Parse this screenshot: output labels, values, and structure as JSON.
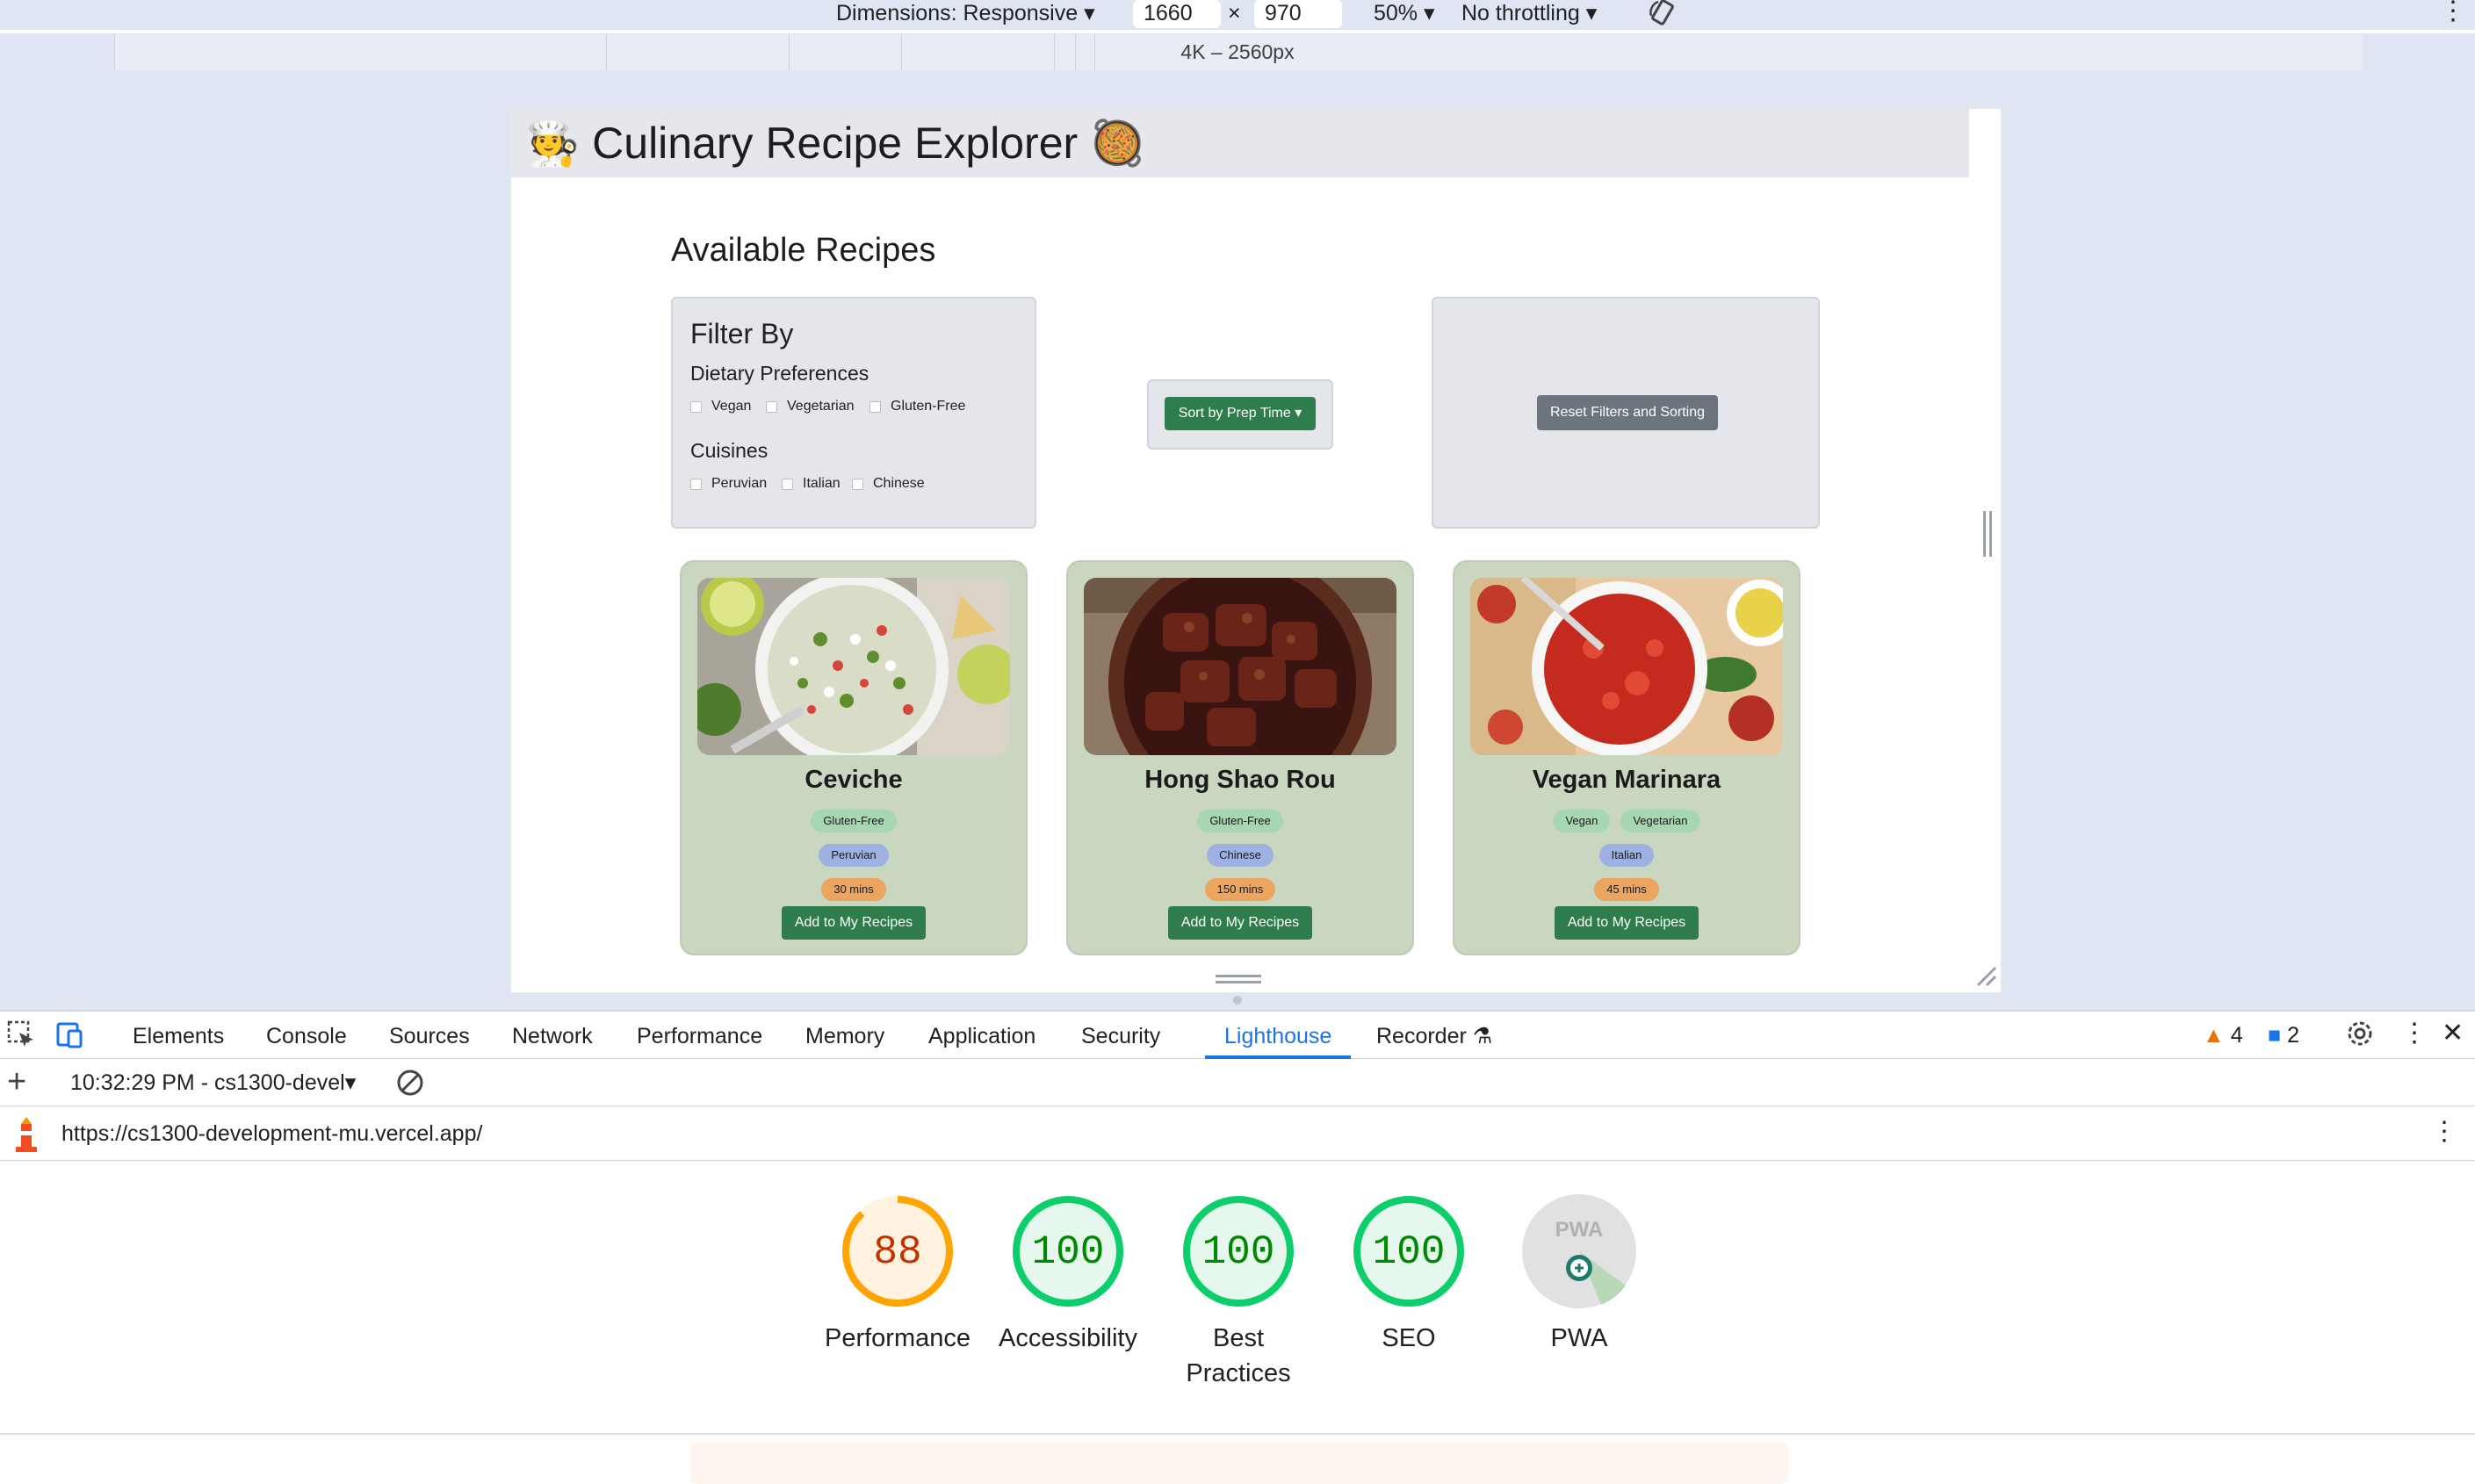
{
  "toolbar": {
    "dimensions_label": "Dimensions: Responsive",
    "width_value": "1660",
    "times_sign": "×",
    "height_value": "970",
    "zoom": "50%",
    "throttling": "No throttling"
  },
  "ruler": {
    "label": "4K – 2560px"
  },
  "app": {
    "title": "🧑‍🍳 Culinary Recipe Explorer 🥘",
    "section_title": "Available Recipes",
    "filter": {
      "heading": "Filter By",
      "dietary_heading": "Dietary Preferences",
      "dietary_options": [
        "Vegan",
        "Vegetarian",
        "Gluten-Free"
      ],
      "cuisines_heading": "Cuisines",
      "cuisine_options": [
        "Peruvian",
        "Italian",
        "Chinese"
      ]
    },
    "sort_button": "Sort by Prep Time ▾",
    "reset_button": "Reset Filters and Sorting",
    "recipes": [
      {
        "name": "Ceviche",
        "diets": [
          "Gluten-Free"
        ],
        "cuisine": "Peruvian",
        "time": "30 mins",
        "button": "Add to My Recipes"
      },
      {
        "name": "Hong Shao Rou",
        "diets": [
          "Gluten-Free"
        ],
        "cuisine": "Chinese",
        "time": "150 mins",
        "button": "Add to My Recipes"
      },
      {
        "name": "Vegan Marinara",
        "diets": [
          "Vegan",
          "Vegetarian"
        ],
        "cuisine": "Italian",
        "time": "45 mins",
        "button": "Add to My Recipes"
      }
    ]
  },
  "devtools": {
    "tabs": [
      "Elements",
      "Console",
      "Sources",
      "Network",
      "Performance",
      "Memory",
      "Application",
      "Security",
      "Lighthouse",
      "Recorder"
    ],
    "active_tab": "Lighthouse",
    "warnings_count": "4",
    "messages_count": "2",
    "session": "10:32:29 PM - cs1300-devel",
    "url": "https://cs1300-development-mu.vercel.app/"
  },
  "lighthouse": {
    "scores": [
      {
        "label": "Performance",
        "value": "88",
        "score": 88
      },
      {
        "label": "Accessibility",
        "value": "100",
        "score": 100
      },
      {
        "label": "Best Practices",
        "value": "100",
        "score": 100
      },
      {
        "label": "SEO",
        "value": "100",
        "score": 100
      }
    ],
    "pwa": {
      "label": "PWA",
      "badge": "PWA"
    }
  },
  "colors": {
    "pass": "#0cce6b",
    "pass_text": "#008800",
    "average": "#ffa400",
    "average_text": "#c33300",
    "accent": "#1a73e8",
    "button_green": "#2f7d4c"
  }
}
